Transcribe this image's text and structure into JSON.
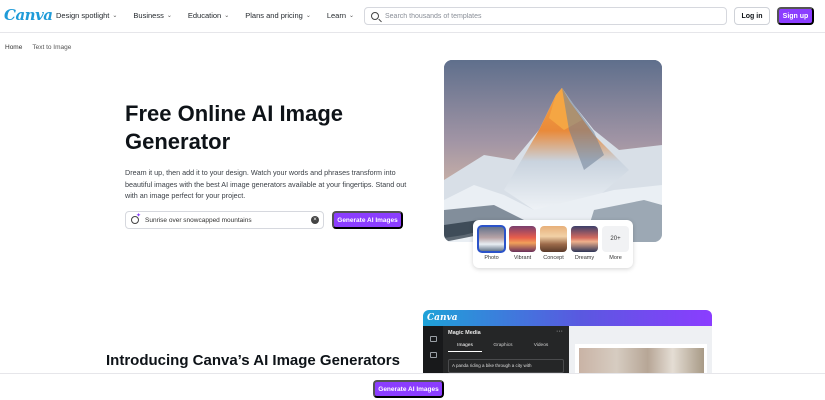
{
  "nav": {
    "logo": "Canva",
    "menu": [
      {
        "label": "Design spotlight"
      },
      {
        "label": "Business"
      },
      {
        "label": "Education"
      },
      {
        "label": "Plans and pricing"
      },
      {
        "label": "Learn"
      }
    ],
    "search_placeholder": "Search thousands of templates",
    "login": "Log in",
    "signup": "Sign up"
  },
  "breadcrumb": [
    "Home",
    "Text to Image"
  ],
  "hero": {
    "title": "Free Online AI Image Generator",
    "description": "Dream it up, then add it to your design. Watch your words and phrases transform into beautiful images with the best AI image generators available at your fingertips. Stand out with an image perfect for your project.",
    "prompt_value": "Sunrise over snowcapped mountains",
    "generate_button": "Generate AI Images"
  },
  "styles": {
    "selected": "Photo",
    "options": [
      "Photo",
      "Vibrant",
      "Concept",
      "Dreamy"
    ],
    "more_count": "20+",
    "more_label": "More"
  },
  "intro": {
    "title": "Introducing Canva’s AI Image Generators"
  },
  "app_preview": {
    "logo": "Canva",
    "panel_title": "Magic Media",
    "tabs": [
      "Images",
      "Graphics",
      "Videos"
    ],
    "active_tab": "Images",
    "input_text": "A panda riding a bike through a city with"
  },
  "bottom_bar": {
    "button": "Generate AI Images"
  },
  "colors": {
    "brand_purple": "#8b3dff",
    "selected_outline": "#2b53c9"
  }
}
